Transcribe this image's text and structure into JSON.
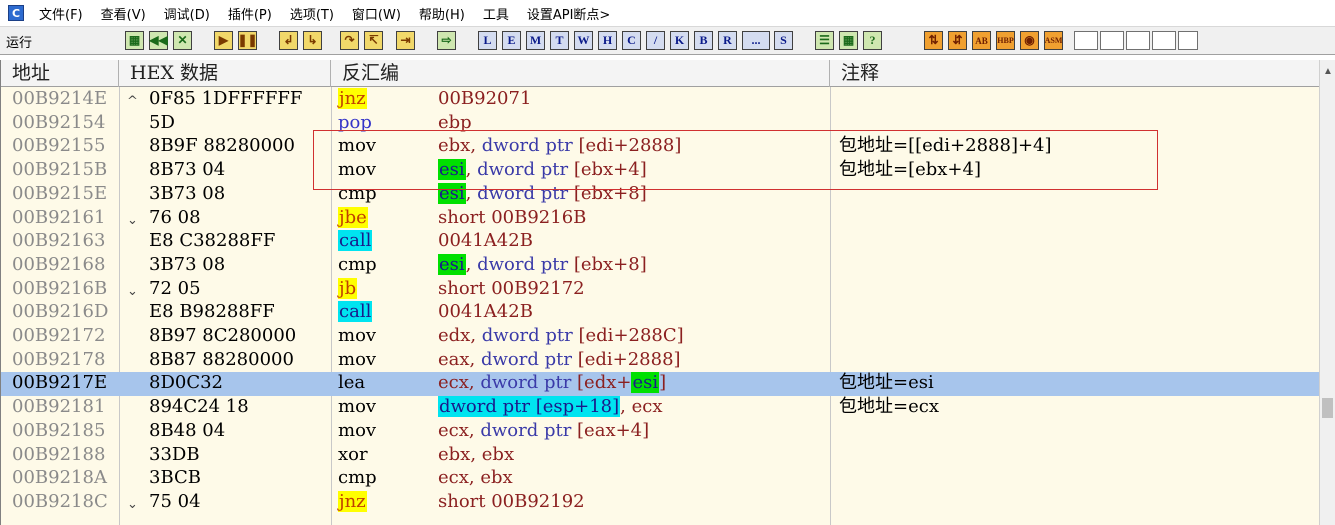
{
  "menubar": {
    "icon": "C",
    "items": [
      "文件(F)",
      "查看(V)",
      "调试(D)",
      "插件(P)",
      "选项(T)",
      "窗口(W)",
      "帮助(H)",
      "工具",
      "设置API断点>"
    ]
  },
  "toolbar": {
    "status": "运行",
    "letters": [
      "L",
      "E",
      "M",
      "T",
      "W",
      "H",
      "C",
      "/",
      "K",
      "B",
      "R",
      "...",
      "S"
    ],
    "icons": [
      "open-icon",
      "restart-icon",
      "close-icon",
      "run-icon",
      "pause-icon",
      "step-into-icon",
      "step-over-icon",
      "trace-into-icon",
      "trace-over-icon",
      "execute-till-return-icon",
      "goto-icon",
      "list-icon",
      "window-icon",
      "help-icon",
      "plugin-icon",
      "plugin2-icon",
      "ab-icon",
      "hbp-icon",
      "bp-icon",
      "asm-icon"
    ],
    "labels": {
      "hbp": "HBP",
      "asm": "ASM",
      "ab": "AB"
    }
  },
  "table": {
    "headers": [
      "地址",
      "HEX 数据",
      "反汇编",
      "注释"
    ],
    "rows": [
      {
        "addr": "00B9214E",
        "mark": "^",
        "hex": "0F85 1DFFFFFF",
        "mn": "jnz",
        "op": "00B92071",
        "cm": ""
      },
      {
        "addr": "00B92154",
        "mark": "",
        "hex": "5D",
        "mn": "pop",
        "op": "ebp",
        "cm": ""
      },
      {
        "addr": "00B92155",
        "mark": "",
        "hex": "8B9F 88280000",
        "mn": "mov",
        "op": "ebx, dword ptr [edi+2888]",
        "cm": "包地址=[[edi+2888]+4]"
      },
      {
        "addr": "00B9215B",
        "mark": "",
        "hex": "8B73 04",
        "mn": "mov",
        "op": "esi, dword ptr [ebx+4]",
        "cm": "包地址=[ebx+4]"
      },
      {
        "addr": "00B9215E",
        "mark": "",
        "hex": "3B73 08",
        "mn": "cmp",
        "op": "esi, dword ptr [ebx+8]",
        "cm": ""
      },
      {
        "addr": "00B92161",
        "mark": "v",
        "hex": "76 08",
        "mn": "jbe",
        "op": "short 00B9216B",
        "cm": ""
      },
      {
        "addr": "00B92163",
        "mark": "",
        "hex": "E8 C38288FF",
        "mn": "call",
        "op": "0041A42B",
        "cm": ""
      },
      {
        "addr": "00B92168",
        "mark": "",
        "hex": "3B73 08",
        "mn": "cmp",
        "op": "esi, dword ptr [ebx+8]",
        "cm": ""
      },
      {
        "addr": "00B9216B",
        "mark": "v",
        "hex": "72 05",
        "mn": "jb",
        "op": "short 00B92172",
        "cm": ""
      },
      {
        "addr": "00B9216D",
        "mark": "",
        "hex": "E8 B98288FF",
        "mn": "call",
        "op": "0041A42B",
        "cm": ""
      },
      {
        "addr": "00B92172",
        "mark": "",
        "hex": "8B97 8C280000",
        "mn": "mov",
        "op": "edx, dword ptr [edi+288C]",
        "cm": ""
      },
      {
        "addr": "00B92178",
        "mark": "",
        "hex": "8B87 88280000",
        "mn": "mov",
        "op": "eax, dword ptr [edi+2888]",
        "cm": ""
      },
      {
        "addr": "00B9217E",
        "mark": "",
        "hex": "8D0C32",
        "mn": "lea",
        "op": "ecx, dword ptr [edx+esi]",
        "cm": "包地址=esi",
        "selected": true
      },
      {
        "addr": "00B92181",
        "mark": "",
        "hex": "894C24 18",
        "mn": "mov",
        "op": "dword ptr [esp+18], ecx",
        "cm": "包地址=ecx"
      },
      {
        "addr": "00B92185",
        "mark": "",
        "hex": "8B48 04",
        "mn": "mov",
        "op": "ecx, dword ptr [eax+4]",
        "cm": ""
      },
      {
        "addr": "00B92188",
        "mark": "",
        "hex": "33DB",
        "mn": "xor",
        "op": "ebx, ebx",
        "cm": ""
      },
      {
        "addr": "00B9218A",
        "mark": "",
        "hex": "3BCB",
        "mn": "cmp",
        "op": "ecx, ebx",
        "cm": ""
      },
      {
        "addr": "00B9218C",
        "mark": "v",
        "hex": "75 04",
        "mn": "jnz",
        "op": "short 00B92192",
        "cm": ""
      }
    ]
  },
  "colors": {
    "jump_highlight": "#ffff00",
    "call_highlight": "#00e4f0",
    "register_highlight": "#00e000",
    "selected_row": "#a7c5ec",
    "annotation_box": "#d03030"
  }
}
